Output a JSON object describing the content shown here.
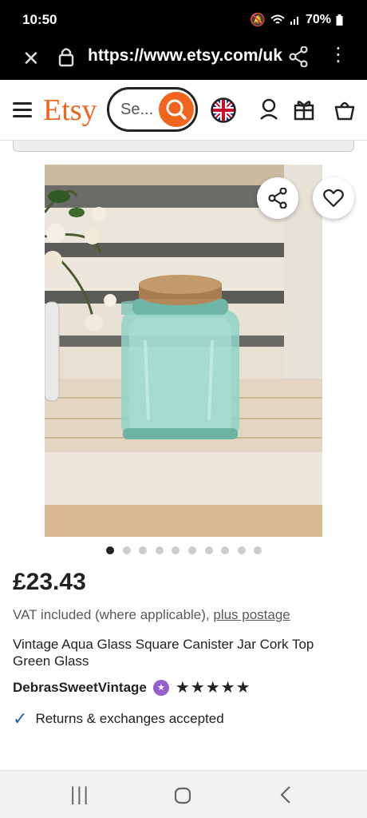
{
  "status": {
    "time": "10:50",
    "battery": "70%"
  },
  "browser": {
    "url": "https://www.etsy.com/uk"
  },
  "header": {
    "logo": "Etsy",
    "search_placeholder": "Se..."
  },
  "product": {
    "price": "£23.43",
    "vat_text": "VAT included (where applicable), ",
    "postage_link": "plus postage",
    "title": "Vintage Aqua Glass Square Canister Jar Cork Top Green Glass",
    "shop_name": "DebrasSweetVintage",
    "rating_stars": "★★★★★",
    "rating": 5,
    "returns": "Returns & exchanges accepted",
    "image_count": 10,
    "active_image": 1
  },
  "colors": {
    "brand": "#f1641e",
    "check": "#2a5db0",
    "star_seller": "#9560c8"
  }
}
